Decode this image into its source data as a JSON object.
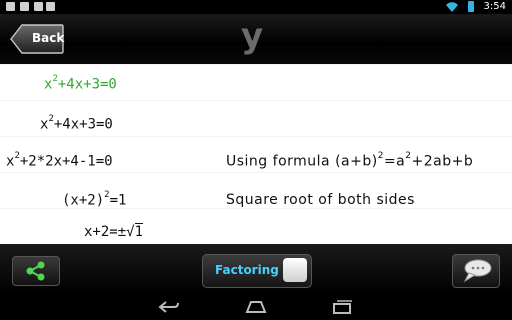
{
  "status_bar": {
    "time": "3:54"
  },
  "header": {
    "back_label": "Back",
    "title": "y"
  },
  "steps": [
    {
      "equation": {
        "base": "x",
        "sup": "2",
        "rest": "+4x+3=0"
      },
      "note": null,
      "highlight": true
    },
    {
      "equation": {
        "base": "x",
        "sup": "2",
        "rest": "+4x+3=0"
      },
      "note": null,
      "highlight": false
    },
    {
      "equation": {
        "base": "x",
        "sup": "2",
        "rest": "+2*2x+4-1=0"
      },
      "note": {
        "prefix": "Using formula (a+b)",
        "sup1": "2",
        "mid": "=a",
        "sup2": "2",
        "rest": "+2ab+b"
      },
      "highlight": false
    },
    {
      "equation": {
        "base": "(x+2)",
        "sup": "2",
        "rest": "=1"
      },
      "note": {
        "prefix": "Square root of both sides"
      },
      "highlight": false
    },
    {
      "equation": {
        "base": "x+2=±",
        "sqrt": "1"
      },
      "note": null,
      "highlight": false
    }
  ],
  "bottom_bar": {
    "toggle_label": "Factoring",
    "toggle_on": true
  },
  "icons": {
    "share": "share-icon",
    "chat": "chat-bubble-icon",
    "back": "nav-back-icon",
    "home": "nav-home-icon",
    "recent": "nav-recent-apps-icon"
  },
  "colors": {
    "accent": "#45d0ff",
    "highlight_green": "#2fa82f"
  }
}
